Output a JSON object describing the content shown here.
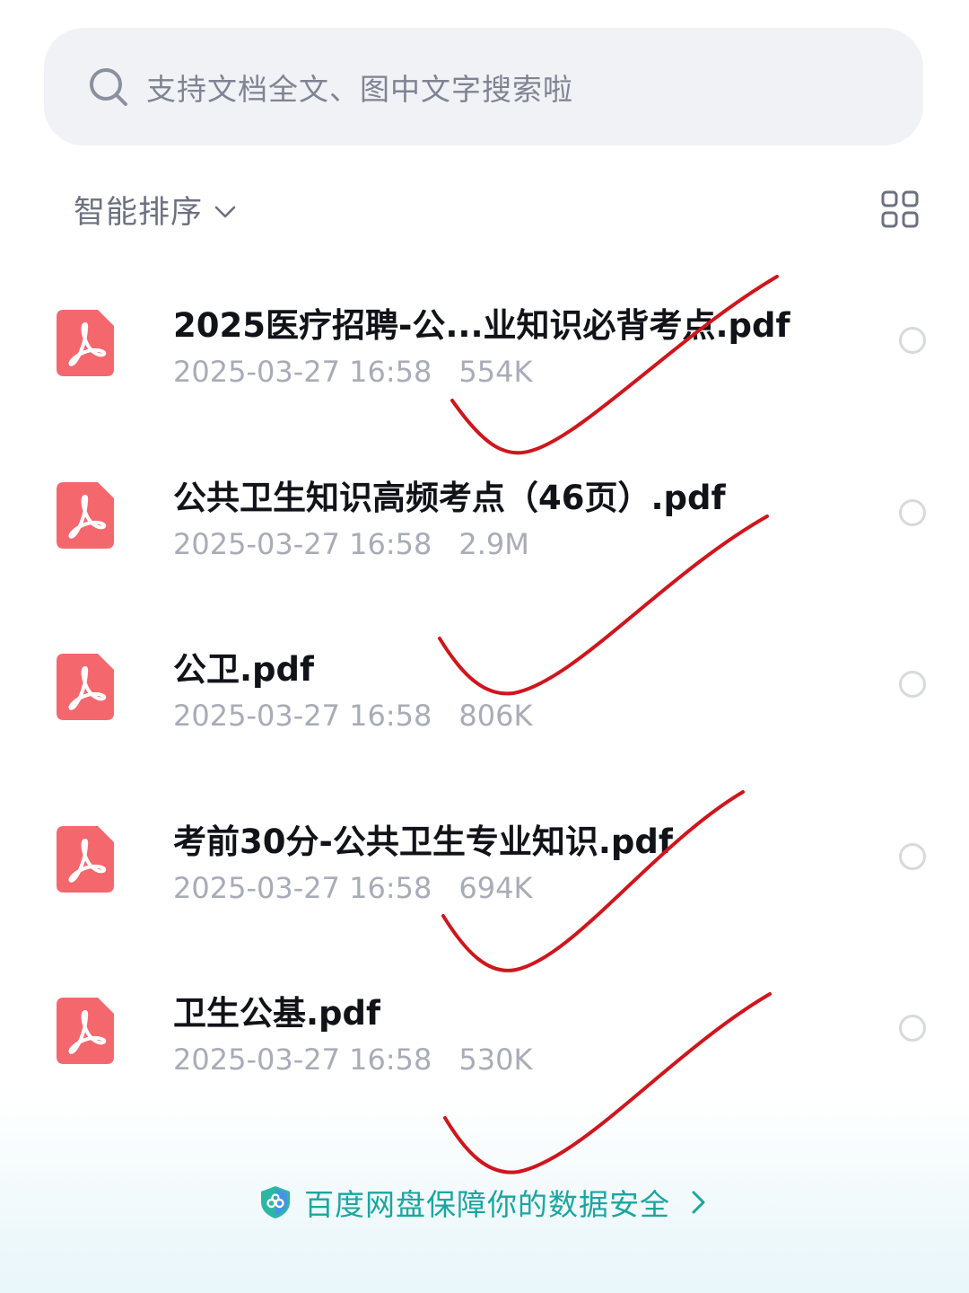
{
  "search": {
    "placeholder": "支持文档全文、图中文字搜索啦"
  },
  "sort": {
    "label": "智能排序"
  },
  "files": [
    {
      "name": "2025医疗招聘-公...业知识必背考点.pdf",
      "datetime": "2025-03-27 16:58",
      "size": "554K",
      "icon": "pdf-icon"
    },
    {
      "name": "公共卫生知识高频考点（46页）.pdf",
      "datetime": "2025-03-27 16:58",
      "size": "2.9M",
      "icon": "pdf-icon"
    },
    {
      "name": "公卫.pdf",
      "datetime": "2025-03-27 16:58",
      "size": "806K",
      "icon": "pdf-icon"
    },
    {
      "name": "考前30分-公共卫生专业知识.pdf",
      "datetime": "2025-03-27 16:58",
      "size": "694K",
      "icon": "pdf-icon"
    },
    {
      "name": "卫生公基.pdf",
      "datetime": "2025-03-27 16:58",
      "size": "530K",
      "icon": "pdf-icon"
    }
  ],
  "footer": {
    "security_text": "百度网盘保障你的数据安全"
  },
  "colors": {
    "pdf_icon": "#f4676d",
    "accent_teal": "#1aa6a0",
    "annotation_red": "#d0151c",
    "search_bg": "#f1f2f6"
  }
}
